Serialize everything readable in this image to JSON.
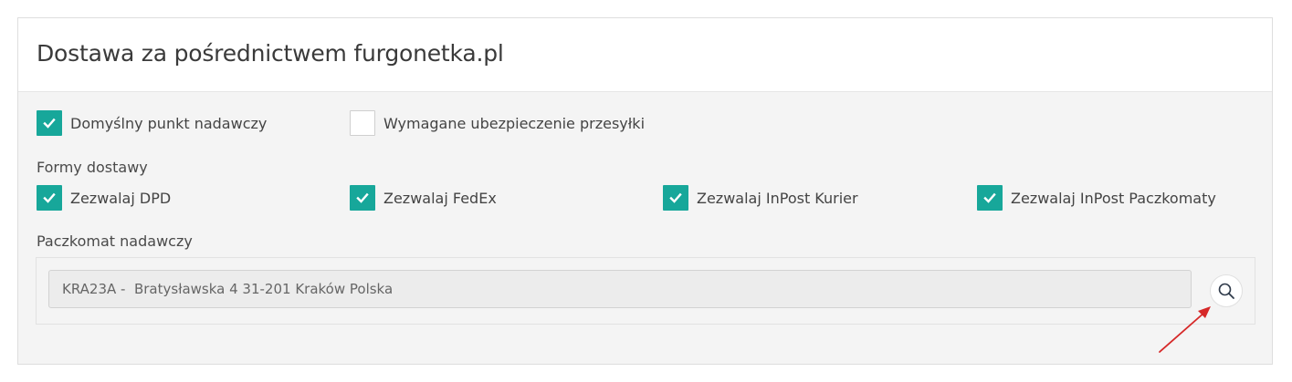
{
  "header": {
    "title": "Dostawa za pośrednictwem furgonetka.pl"
  },
  "options": [
    {
      "label": "Domyślny punkt nadawczy",
      "checked": true
    },
    {
      "label": "Wymagane ubezpieczenie przesyłki",
      "checked": false
    }
  ],
  "delivery_forms": {
    "label": "Formy dostawy",
    "items": [
      {
        "label": "Zezwalaj DPD",
        "checked": true
      },
      {
        "label": "Zezwalaj FedEx",
        "checked": true
      },
      {
        "label": "Zezwalaj InPost Kurier",
        "checked": true
      },
      {
        "label": "Zezwalaj InPost Paczkomaty",
        "checked": true
      }
    ]
  },
  "locker": {
    "label": "Paczkomat nadawczy",
    "value": "KRA23A -  Bratysławska 4 31-201 Kraków Polska",
    "search_icon": "search-icon"
  },
  "colors": {
    "accent": "#17a79a",
    "annotation_arrow": "#d62828"
  }
}
